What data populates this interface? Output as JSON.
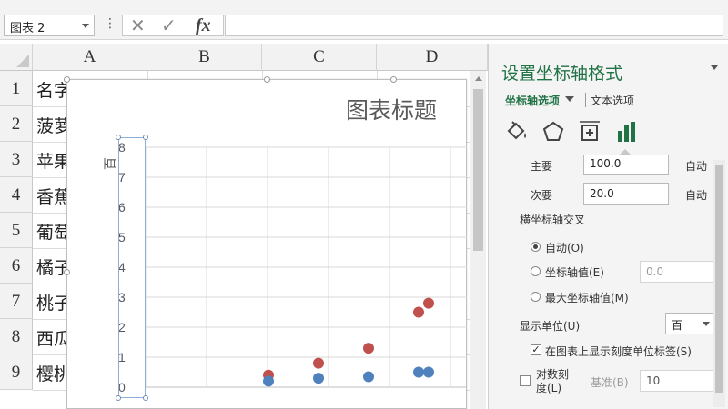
{
  "formula_bar": {
    "name_box": "图表 2",
    "sep": "⋮",
    "cancel": "✕",
    "confirm": "✓",
    "fx": "fx",
    "formula": ""
  },
  "columns": [
    "A",
    "B",
    "C",
    "D"
  ],
  "rows": [
    "1",
    "2",
    "3",
    "4",
    "5",
    "6",
    "7",
    "8",
    "9"
  ],
  "cells_a": [
    "名字",
    "菠萝",
    "苹果",
    "香蕉",
    "葡萄",
    "橘子",
    "桃子",
    "西瓜",
    "樱桃"
  ],
  "chart": {
    "title": "图表标题",
    "unit_label": "百",
    "y_ticks": [
      "8",
      "7",
      "6",
      "5",
      "4",
      "3",
      "2",
      "1",
      "0"
    ]
  },
  "chart_data": {
    "type": "scatter",
    "title": "图表标题",
    "ylabel": "百",
    "ylim": [
      0,
      8
    ],
    "x": [
      1,
      2,
      3,
      4,
      4.2
    ],
    "series": [
      {
        "color": "#c0504d",
        "values": [
          0.4,
          0.8,
          1.3,
          2.5,
          2.8
        ]
      },
      {
        "color": "#4f81bd",
        "values": [
          0.2,
          0.3,
          0.35,
          0.5,
          0.5
        ]
      }
    ]
  },
  "pane": {
    "title": "设置坐标轴格式",
    "tab_axis": "坐标轴选项",
    "tab_text": "文本选项",
    "icons": [
      "fill-icon",
      "pentagon-icon",
      "size-properties-icon",
      "bar-chart-icon"
    ],
    "major_label": "主要",
    "major_value": "100.0",
    "major_auto": "自动",
    "minor_label": "次要",
    "minor_value": "20.0",
    "minor_auto": "自动",
    "cross_heading": "横坐标轴交叉",
    "radio_auto": "自动(O)",
    "radio_axis_value": "坐标轴值(E)",
    "axis_value": "0.0",
    "radio_max": "最大坐标轴值(M)",
    "display_unit_label": "显示单位(U)",
    "display_unit_value": "百",
    "show_unit_label": "在图表上显示刻度单位标签(S)",
    "log_scale": "对数刻度(L)",
    "base_label": "基准(B)",
    "base_value": "10",
    "accent_color": "#217346"
  }
}
